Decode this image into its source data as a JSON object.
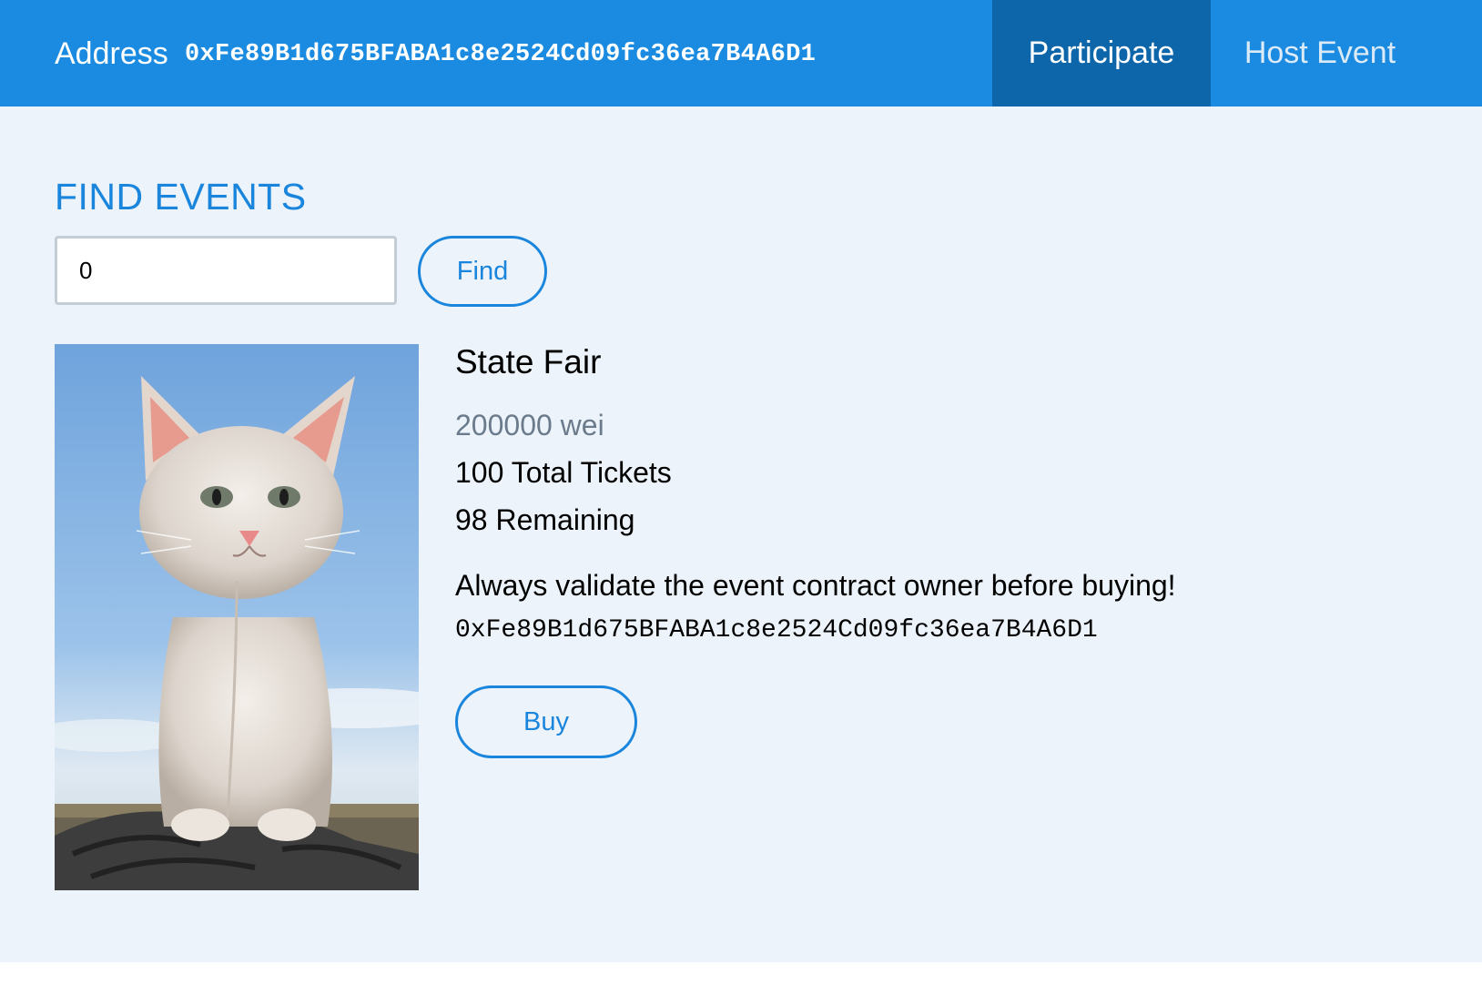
{
  "header": {
    "address_label": "Address",
    "address_value": "0xFe89B1d675BFABA1c8e2524Cd09fc36ea7B4A6D1",
    "tabs": [
      {
        "label": "Participate",
        "active": true
      },
      {
        "label": "Host Event",
        "active": false
      }
    ]
  },
  "find": {
    "title": "FIND EVENTS",
    "input_value": "0",
    "button_label": "Find"
  },
  "event": {
    "title": "State Fair",
    "price": "200000 wei",
    "total_tickets": "100 Total Tickets",
    "remaining": "98 Remaining",
    "warning": "Always validate the event contract owner before buying!",
    "owner_address": "0xFe89B1d675BFABA1c8e2524Cd09fc36ea7B4A6D1",
    "buy_label": "Buy",
    "image": "kitten-photo"
  },
  "colors": {
    "header_bg": "#1a8be0",
    "active_tab_bg": "#0e66aa",
    "page_bg": "#ecf3fa",
    "accent": "#1a85dc",
    "price_text": "#6b7b8c"
  }
}
